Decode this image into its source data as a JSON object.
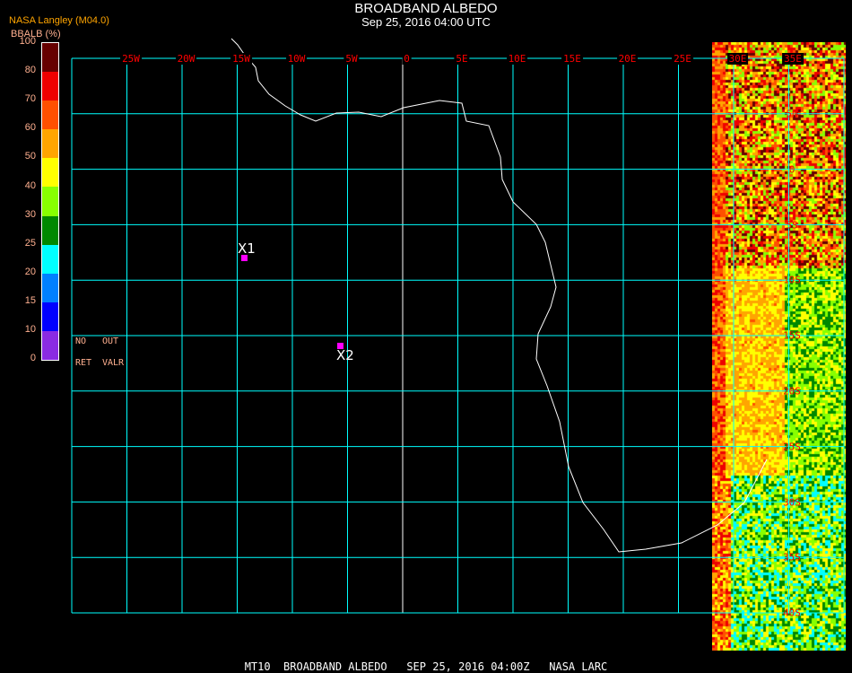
{
  "header": {
    "title": "BROADBAND ALBEDO",
    "datetime": "Sep 25, 2016 04:00 UTC",
    "source": "NASA Langley (M04.0)"
  },
  "legend": {
    "unit": "BBALB (%)",
    "labels": [
      "100",
      "80",
      "70",
      "60",
      "50",
      "40",
      "30",
      "25",
      "20",
      "15",
      "10",
      "0"
    ],
    "colors": [
      "#660000",
      "#ee0000",
      "#ff5000",
      "#ffa500",
      "#ffff00",
      "#88ff00",
      "#008800",
      "#00ffff",
      "#0080ff",
      "#0000ff",
      "#8a2be2"
    ],
    "no_ret": [
      "NO",
      "RET"
    ],
    "out_valr": [
      "OUT",
      "VALR"
    ]
  },
  "grid": {
    "line_color": "#00ffff",
    "label_color": "#ff0000",
    "lon_labels": [
      "25W",
      "20W",
      "15W",
      "10W",
      "5W",
      "0",
      "5E",
      "10E",
      "15E",
      "20E",
      "25E",
      "30E",
      "35E"
    ],
    "lat_labels": [
      "5N",
      "0",
      "5S",
      "10S",
      "15S",
      "20S",
      "25S",
      "30S",
      "35S",
      "40S"
    ]
  },
  "markers": [
    {
      "label": "X1",
      "color": "#ff00ff"
    },
    {
      "label": "X2",
      "color": "#ff00ff"
    }
  ],
  "footer": "MT10  BROADBAND ALBEDO   SEP 25, 2016 04:00Z   NASA LARC"
}
